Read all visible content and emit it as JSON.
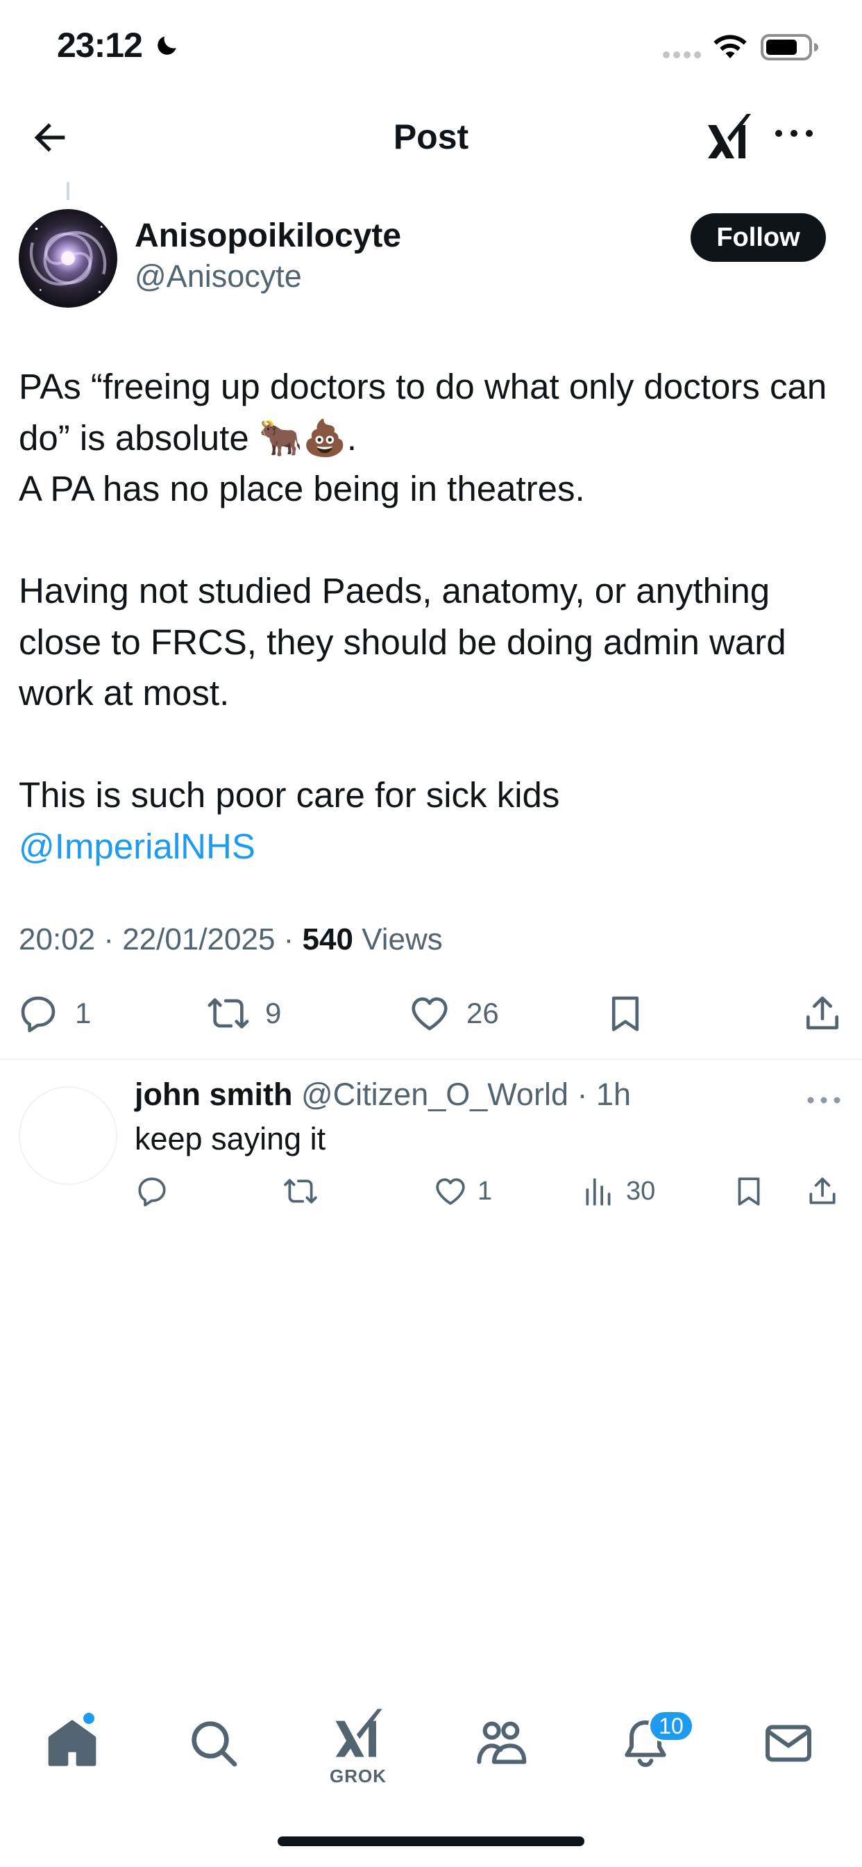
{
  "status_bar": {
    "time": "23:12",
    "icons": [
      "moon-icon",
      "signal-icon",
      "wifi-icon",
      "battery-icon"
    ]
  },
  "header": {
    "title": "Post",
    "back_icon": "arrow-left-icon",
    "grok_icon": "grok-icon",
    "more_icon": "more-icon"
  },
  "post": {
    "author_name": "Anisopoikilocyte",
    "author_handle": "@Anisocyte",
    "follow_label": "Follow",
    "lines": [
      "PAs “freeing up doctors to do what only doctors can do” is absolute 🐂💩.",
      "A PA has no place being in theatres.",
      "",
      "Having not studied Paeds, anatomy, or anything close to FRCS, they should be doing admin ward work at most.",
      "",
      "This is such poor care for sick kids"
    ],
    "mention": "@ImperialNHS",
    "timestamp": "20:02 · 22/01/2025 · ",
    "views_count": "540",
    "views_label": " Views",
    "stats": {
      "replies": "1",
      "reposts": "9",
      "likes": "26"
    }
  },
  "reply": {
    "name": "john smith",
    "handle": " @Citizen_O_World · 1h",
    "text": "keep saying it",
    "likes": "1",
    "views": "30"
  },
  "tab_bar": {
    "grok_label": "GROK",
    "notification_count": "10"
  },
  "colors": {
    "accent": "#1d9bf0",
    "text_primary": "#0f1419",
    "text_secondary": "#536471",
    "divider": "#eff3f4"
  }
}
